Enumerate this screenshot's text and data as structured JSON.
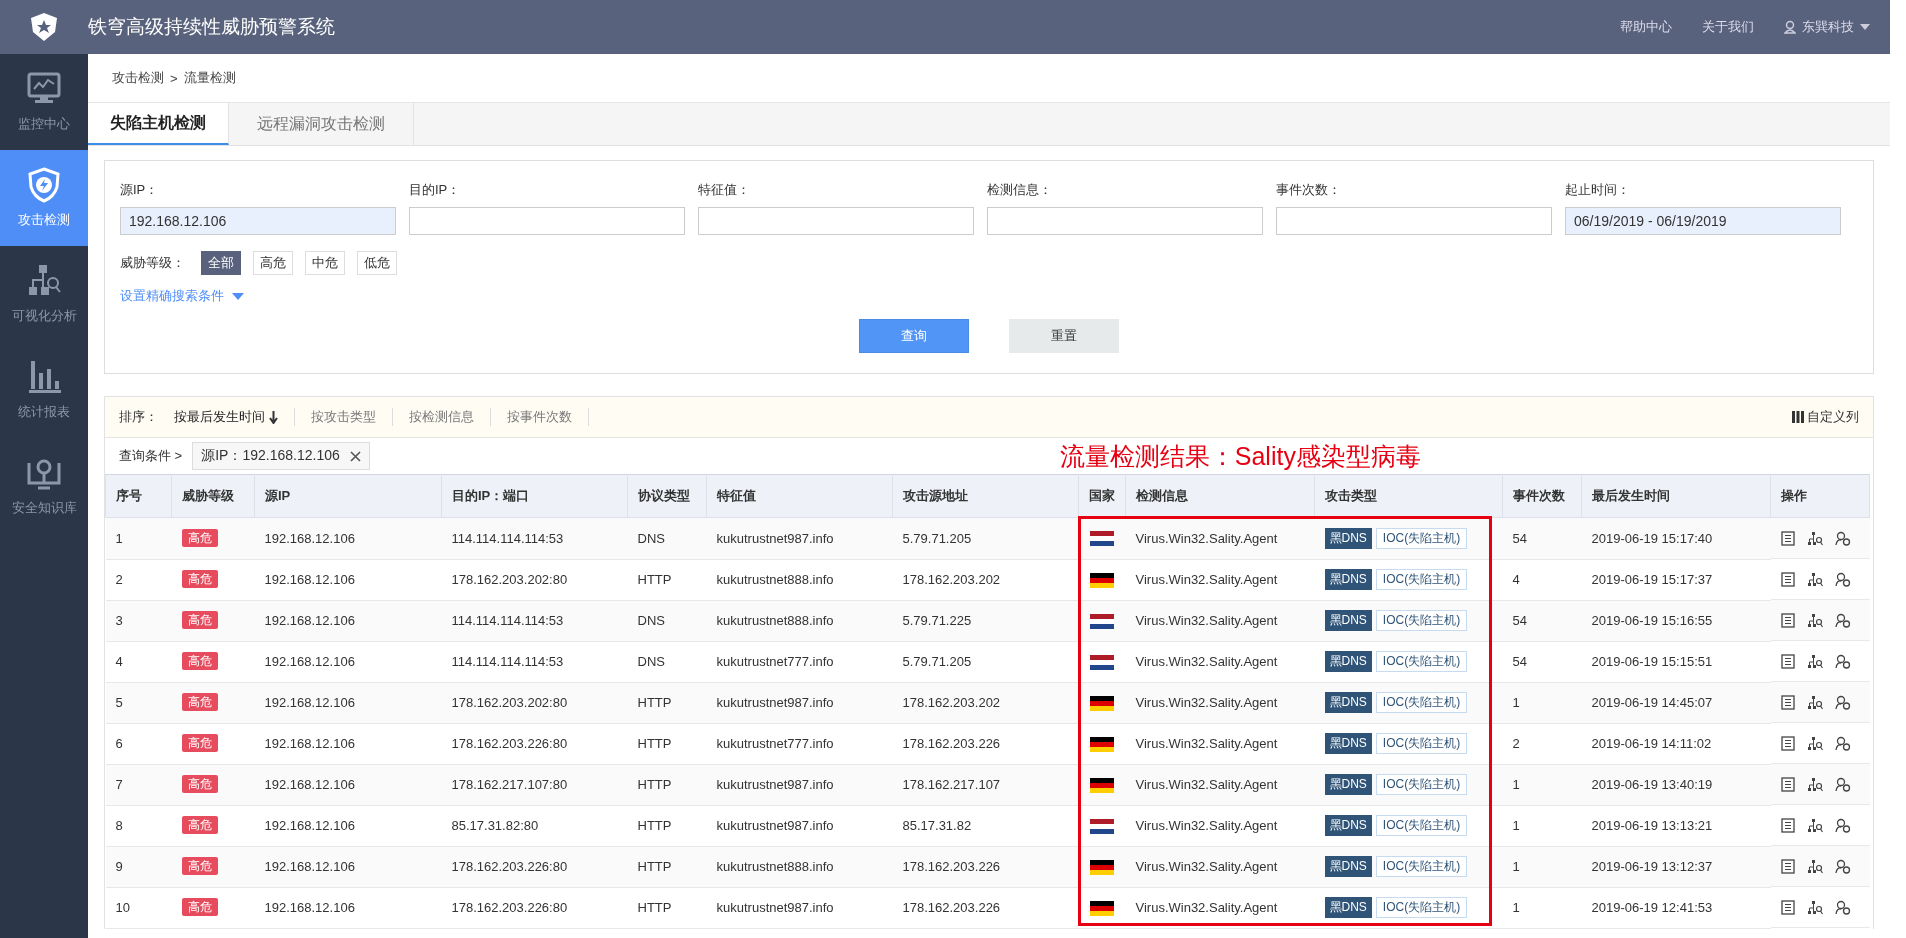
{
  "header": {
    "title": "铁穹高级持续性威胁预警系统",
    "links": [
      "帮助中心",
      "关于我们"
    ],
    "user": "东巽科技"
  },
  "sidebar": {
    "items": [
      {
        "label": "监控中心",
        "selected": false
      },
      {
        "label": "攻击检测",
        "selected": true
      },
      {
        "label": "可视化分析",
        "selected": false
      },
      {
        "label": "统计报表",
        "selected": false
      },
      {
        "label": "安全知识库",
        "selected": false
      }
    ]
  },
  "breadcrumb": {
    "items": [
      "攻击检测",
      "流量检测"
    ],
    "separator": ">"
  },
  "tabs": [
    {
      "label": "失陷主机检测",
      "selected": true
    },
    {
      "label": "远程漏洞攻击检测",
      "selected": false
    }
  ],
  "filters": {
    "fields": [
      {
        "label": "源IP：",
        "value": "192.168.12.106"
      },
      {
        "label": "目的IP："
      },
      {
        "label": "特征值："
      },
      {
        "label": "检测信息："
      },
      {
        "label": "事件次数："
      },
      {
        "label": "起止时间：",
        "value": "06/19/2019 - 06/19/2019"
      }
    ],
    "level_label": "威胁等级：",
    "levels": [
      {
        "label": "全部",
        "selected": true
      },
      {
        "label": "高危",
        "selected": false
      },
      {
        "label": "中危",
        "selected": false
      },
      {
        "label": "低危",
        "selected": false
      }
    ],
    "advanced": "设置精确搜索条件",
    "buttons": [
      {
        "label": "查询",
        "kind": "primary"
      },
      {
        "label": "重置",
        "kind": "secondary"
      }
    ]
  },
  "sort": {
    "label": "排序：",
    "options": [
      {
        "label": "按最后发生时间",
        "selected": true
      },
      {
        "label": "按攻击类型",
        "selected": false
      },
      {
        "label": "按检测信息",
        "selected": false
      },
      {
        "label": "按事件次数",
        "selected": false
      }
    ],
    "custom_columns": "自定义列"
  },
  "conditions": {
    "label": "查询条件 >",
    "tags": [
      "源IP：192.168.12.106"
    ]
  },
  "annotation": "流量检测结果：Sality感染型病毒",
  "table": {
    "columns": [
      "序号",
      "威胁等级",
      "源IP",
      "目的IP：端口",
      "协议类型",
      "特征值",
      "攻击源地址",
      "国家",
      "检测信息",
      "攻击类型",
      "事件次数",
      "最后发生时间",
      "操作"
    ],
    "rows": [
      {
        "no": "1",
        "level": "高危",
        "src": "192.168.12.106",
        "dst": "114.114.114.114:53",
        "proto": "DNS",
        "feature": "kukutrustnet987.info",
        "attacker": "5.79.71.205",
        "kind": "netherlands",
        "info": "Virus.Win32.Sality.Agent",
        "types": [
          "黑DNS",
          "IOC(失陷主机)"
        ],
        "count": "54",
        "time": "2019-06-19 15:17:40"
      },
      {
        "no": "2",
        "level": "高危",
        "src": "192.168.12.106",
        "dst": "178.162.203.202:80",
        "proto": "HTTP",
        "feature": "kukutrustnet888.info",
        "attacker": "178.162.203.202",
        "kind": "germany",
        "info": "Virus.Win32.Sality.Agent",
        "types": [
          "黑DNS",
          "IOC(失陷主机)"
        ],
        "count": "4",
        "time": "2019-06-19 15:17:37"
      },
      {
        "no": "3",
        "level": "高危",
        "src": "192.168.12.106",
        "dst": "114.114.114.114:53",
        "proto": "DNS",
        "feature": "kukutrustnet888.info",
        "attacker": "5.79.71.225",
        "kind": "netherlands",
        "info": "Virus.Win32.Sality.Agent",
        "types": [
          "黑DNS",
          "IOC(失陷主机)"
        ],
        "count": "54",
        "time": "2019-06-19 15:16:55"
      },
      {
        "no": "4",
        "level": "高危",
        "src": "192.168.12.106",
        "dst": "114.114.114.114:53",
        "proto": "DNS",
        "feature": "kukutrustnet777.info",
        "attacker": "5.79.71.205",
        "kind": "netherlands",
        "info": "Virus.Win32.Sality.Agent",
        "types": [
          "黑DNS",
          "IOC(失陷主机)"
        ],
        "count": "54",
        "time": "2019-06-19 15:15:51"
      },
      {
        "no": "5",
        "level": "高危",
        "src": "192.168.12.106",
        "dst": "178.162.203.202:80",
        "proto": "HTTP",
        "feature": "kukutrustnet987.info",
        "attacker": "178.162.203.202",
        "kind": "germany",
        "info": "Virus.Win32.Sality.Agent",
        "types": [
          "黑DNS",
          "IOC(失陷主机)"
        ],
        "count": "1",
        "time": "2019-06-19 14:45:07"
      },
      {
        "no": "6",
        "level": "高危",
        "src": "192.168.12.106",
        "dst": "178.162.203.226:80",
        "proto": "HTTP",
        "feature": "kukutrustnet777.info",
        "attacker": "178.162.203.226",
        "kind": "germany",
        "info": "Virus.Win32.Sality.Agent",
        "types": [
          "黑DNS",
          "IOC(失陷主机)"
        ],
        "count": "2",
        "time": "2019-06-19 14:11:02"
      },
      {
        "no": "7",
        "level": "高危",
        "src": "192.168.12.106",
        "dst": "178.162.217.107:80",
        "proto": "HTTP",
        "feature": "kukutrustnet987.info",
        "attacker": "178.162.217.107",
        "kind": "germany",
        "info": "Virus.Win32.Sality.Agent",
        "types": [
          "黑DNS",
          "IOC(失陷主机)"
        ],
        "count": "1",
        "time": "2019-06-19 13:40:19"
      },
      {
        "no": "8",
        "level": "高危",
        "src": "192.168.12.106",
        "dst": "85.17.31.82:80",
        "proto": "HTTP",
        "feature": "kukutrustnet987.info",
        "attacker": "85.17.31.82",
        "kind": "netherlands",
        "info": "Virus.Win32.Sality.Agent",
        "types": [
          "黑DNS",
          "IOC(失陷主机)"
        ],
        "count": "1",
        "time": "2019-06-19 13:13:21"
      },
      {
        "no": "9",
        "level": "高危",
        "src": "192.168.12.106",
        "dst": "178.162.203.226:80",
        "proto": "HTTP",
        "feature": "kukutrustnet888.info",
        "attacker": "178.162.203.226",
        "kind": "germany",
        "info": "Virus.Win32.Sality.Agent",
        "types": [
          "黑DNS",
          "IOC(失陷主机)"
        ],
        "count": "1",
        "time": "2019-06-19 13:12:37"
      },
      {
        "no": "10",
        "level": "高危",
        "src": "192.168.12.106",
        "dst": "178.162.203.226:80",
        "proto": "HTTP",
        "feature": "kukutrustnet987.info",
        "attacker": "178.162.203.226",
        "kind": "germany",
        "info": "Virus.Win32.Sality.Agent",
        "types": [
          "黑DNS",
          "IOC(失陷主机)"
        ],
        "count": "1",
        "time": "2019-06-19 12:41:53"
      }
    ]
  }
}
